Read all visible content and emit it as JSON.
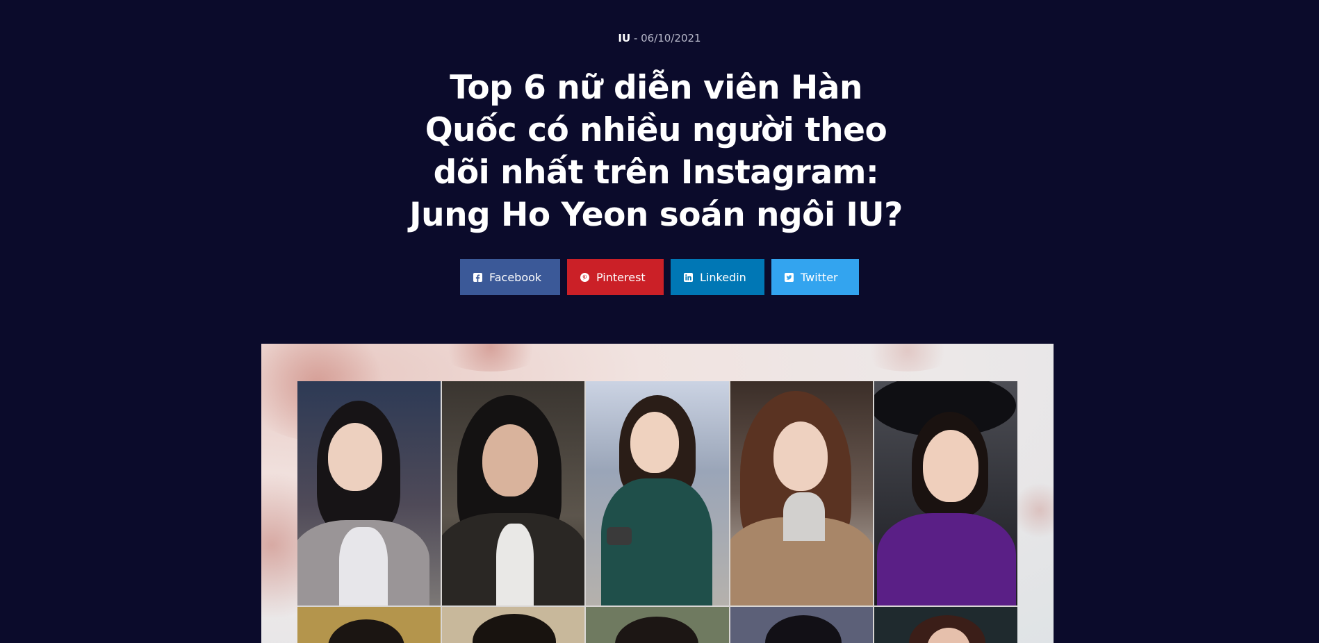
{
  "article": {
    "author": "IU",
    "date_sep": " - ",
    "date": "06/10/2021",
    "title": "Top 6 nữ diễn viên Hàn Quốc có nhiều người theo dõi nhất trên Instagram: Jung Ho Yeon soán ngôi IU?"
  },
  "share": [
    {
      "label": "Facebook",
      "icon": "facebook-icon",
      "color": "#3b5998"
    },
    {
      "label": "Pinterest",
      "icon": "pinterest-icon",
      "color": "#cb2027"
    },
    {
      "label": "Linkedin",
      "icon": "linkedin-icon",
      "color": "#0077b5"
    },
    {
      "label": "Twitter",
      "icon": "twitter-icon",
      "color": "#33a4ef"
    }
  ],
  "colors": {
    "background": "#0b0b2b",
    "title": "#ffffff",
    "meta": "#b7b8c9"
  }
}
